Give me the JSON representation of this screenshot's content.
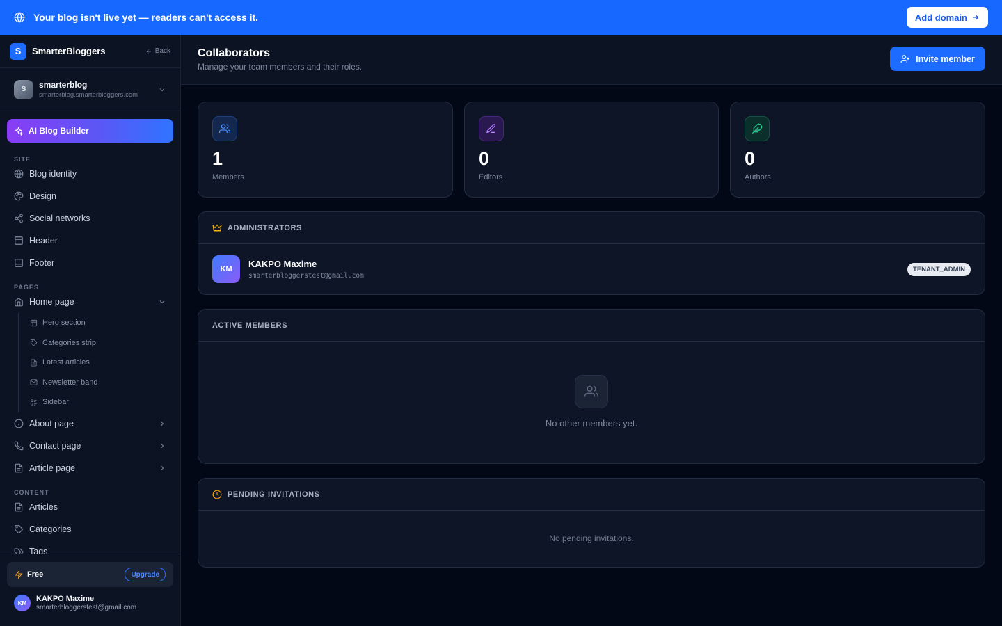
{
  "banner": {
    "message": "Your blog isn't live yet — readers can't access it.",
    "add_domain_label": "Add domain"
  },
  "sidebar": {
    "logo_letter": "S",
    "brand": "SmarterBloggers",
    "back_label": "Back",
    "tenant": {
      "initial": "S",
      "name": "smarterblog",
      "domain": "smarterblog.smarterbloggers.com"
    },
    "ai_builder_label": "AI Blog Builder",
    "sections": {
      "site": "SITE",
      "pages": "PAGES",
      "content": "CONTENT"
    },
    "site_items": [
      "Blog identity",
      "Design",
      "Social networks",
      "Header",
      "Footer"
    ],
    "home_page": "Home page",
    "home_sub_items": [
      "Hero section",
      "Categories strip",
      "Latest articles",
      "Newsletter band",
      "Sidebar"
    ],
    "page_items": [
      "About page",
      "Contact page",
      "Article page"
    ],
    "content_items": [
      "Articles",
      "Categories",
      "Tags"
    ],
    "plan": {
      "label": "Free",
      "upgrade_label": "Upgrade"
    },
    "user": {
      "initials": "KM",
      "name": "KAKPO Maxime",
      "email": "smarterbloggerstest@gmail.com"
    }
  },
  "header": {
    "title": "Collaborators",
    "subtitle": "Manage your team members and their roles.",
    "invite_label": "Invite member"
  },
  "stats": [
    {
      "value": "1",
      "label": "Members"
    },
    {
      "value": "0",
      "label": "Editors"
    },
    {
      "value": "0",
      "label": "Authors"
    }
  ],
  "administrators": {
    "title": "ADMINISTRATORS",
    "members": [
      {
        "initials": "KM",
        "name": "KAKPO Maxime",
        "email": "smarterbloggerstest@gmail.com",
        "role": "TENANT_ADMIN"
      }
    ]
  },
  "active_members": {
    "title": "ACTIVE MEMBERS",
    "empty_text": "No other members yet."
  },
  "pending": {
    "title": "PENDING INVITATIONS",
    "empty_text": "No pending invitations."
  },
  "colors": {
    "accent": "#1d6bff",
    "members_icon": "#3b82f6",
    "editors_icon": "#a855f7",
    "authors_icon": "#10b981",
    "admin_icon": "#f5b316",
    "pending_icon": "#f59e0b"
  }
}
